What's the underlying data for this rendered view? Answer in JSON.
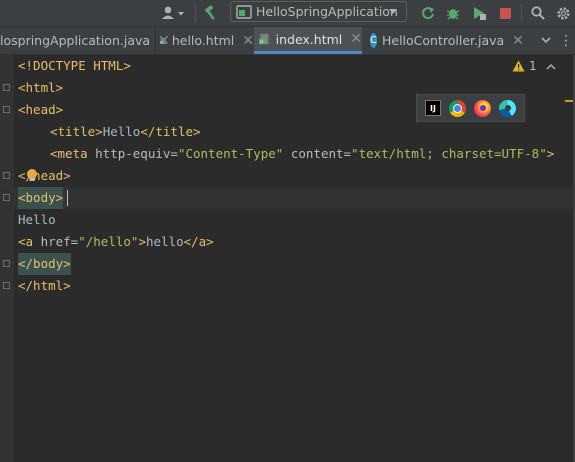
{
  "run_config": {
    "label": "HelloSpringApplication"
  },
  "tabs": [
    {
      "label": "lospringApplication.java",
      "active": false
    },
    {
      "label": "hello.html",
      "active": false
    },
    {
      "label": "index.html",
      "active": true
    },
    {
      "label": "HelloController.java",
      "active": false
    }
  ],
  "inspection": {
    "warning_count": "1"
  },
  "code_lines": [
    "<!DOCTYPE HTML>",
    "<html>",
    "<head>",
    "<title>Hello</title>",
    "<meta http-equiv=\"Content-Type\" content=\"text/html; charset=UTF-8\">",
    "</head>",
    "<body>",
    "Hello",
    "<a href=\"/hello\">hello</a>",
    "</body>",
    "</html>"
  ],
  "colors": {
    "background": "#2b2b2b",
    "tag": "#e8bf6a",
    "string": "#a5c25c",
    "text": "#a9b7c6",
    "active_tab_underline": "#4a88c7"
  },
  "icons": [
    "user-icon",
    "build-hammer-icon",
    "rerun-icon",
    "debug-bug-icon",
    "run-coverage-icon",
    "stop-icon",
    "search-icon",
    "settings-gear-icon",
    "tab-close-icon",
    "tab-overflow-icon",
    "intellij-icon",
    "chrome-icon",
    "firefox-icon",
    "edge-icon",
    "warning-icon",
    "bulb-icon"
  ]
}
